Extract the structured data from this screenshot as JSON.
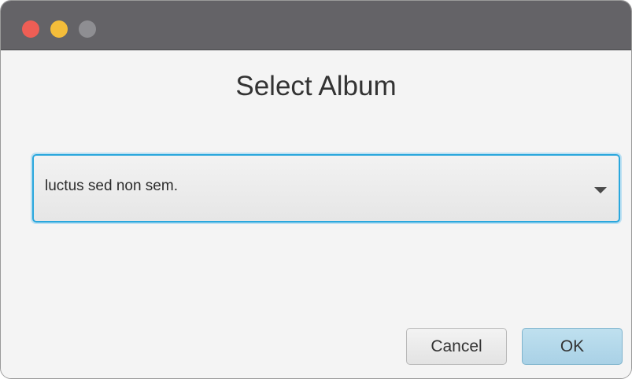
{
  "window": {
    "controls": [
      {
        "name": "close-button",
        "color": "#ee5e55"
      },
      {
        "name": "minimize-button",
        "color": "#f4bd3a"
      },
      {
        "name": "zoom-button",
        "color": "#8e8e92"
      }
    ]
  },
  "dialog": {
    "title": "Select Album",
    "combo": {
      "selected": "luctus sed non sem.",
      "arrow_icon": "chevron-down-icon"
    },
    "buttons": {
      "cancel": "Cancel",
      "ok": "OK"
    }
  },
  "colors": {
    "accent": "#2aa7dd",
    "titlebar": "#646367",
    "ok_button": "#a9d1e6"
  }
}
